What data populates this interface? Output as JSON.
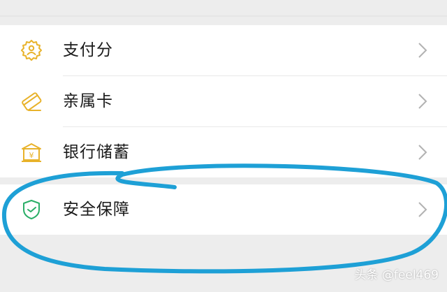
{
  "menu": {
    "items": [
      {
        "label": "支付分",
        "icon": "payment-score-icon",
        "icon_color": "#e8b22a"
      },
      {
        "label": "亲属卡",
        "icon": "family-card-icon",
        "icon_color": "#e8b22a"
      },
      {
        "label": "银行储蓄",
        "icon": "bank-savings-icon",
        "icon_color": "#e8b22a"
      }
    ],
    "security": {
      "label": "安全保障",
      "icon": "shield-check-icon",
      "icon_color": "#2aae67"
    },
    "chevron_color": "#b2b2b2"
  },
  "watermark": {
    "text": "头条 @feel469"
  },
  "annotation": {
    "color": "#1ea0d6",
    "shape": "hand-drawn-ellipse"
  }
}
